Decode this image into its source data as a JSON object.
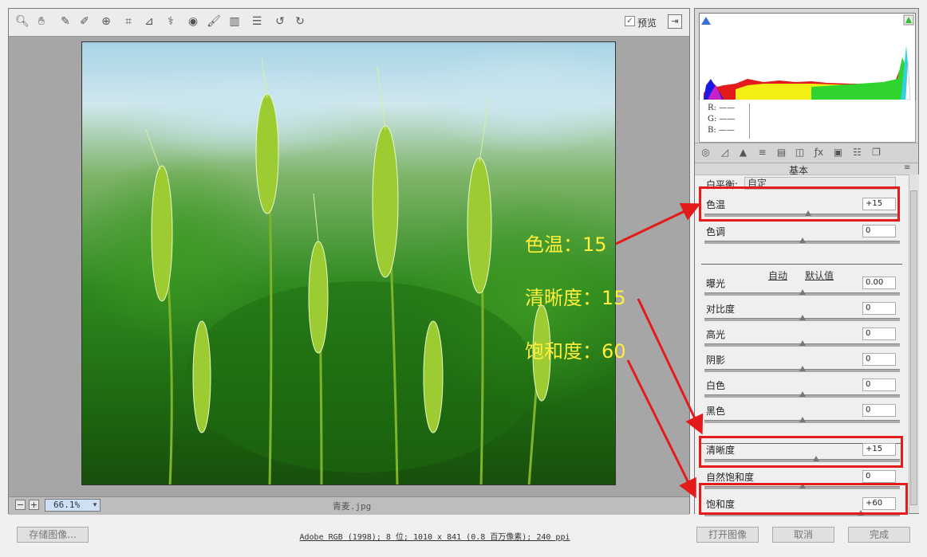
{
  "toolbar": {
    "tools": [
      "zoom-icon",
      "hand-icon",
      "eyedropper-icon",
      "color-sampler-icon",
      "target-adjust-icon",
      "crop-icon",
      "straighten-icon",
      "spot-removal-icon",
      "red-eye-icon",
      "brush-icon",
      "gradient-icon",
      "list-icon",
      "rotate-ccw-icon",
      "rotate-cw-icon"
    ],
    "preview_label": "预览",
    "preview_checked": true
  },
  "status": {
    "zoom_minus": "−",
    "zoom_plus": "+",
    "zoom": "66.1%",
    "filename": "青麦.jpg"
  },
  "histogram": {
    "r_label": "R:",
    "g_label": "G:",
    "b_label": "B:",
    "r_value": "——",
    "g_value": "——",
    "b_value": "——"
  },
  "panel": {
    "title": "基本",
    "white_balance_label": "白平衡:",
    "white_balance_value": "自定",
    "auto_label": "自动",
    "default_label": "默认值",
    "sliders": [
      {
        "label": "色温",
        "value": "+15",
        "position": 0.53
      },
      {
        "label": "色调",
        "value": "0",
        "position": 0.5
      },
      {
        "label": "曝光",
        "value": "0.00",
        "position": 0.5
      },
      {
        "label": "对比度",
        "value": "0",
        "position": 0.5
      },
      {
        "label": "高光",
        "value": "0",
        "position": 0.5
      },
      {
        "label": "阴影",
        "value": "0",
        "position": 0.5
      },
      {
        "label": "白色",
        "value": "0",
        "position": 0.5
      },
      {
        "label": "黑色",
        "value": "0",
        "position": 0.5
      },
      {
        "label": "清晰度",
        "value": "+15",
        "position": 0.57
      },
      {
        "label": "自然饱和度",
        "value": "0",
        "position": 0.5
      },
      {
        "label": "饱和度",
        "value": "+60",
        "position": 0.8
      }
    ]
  },
  "annotations": {
    "temp": "色温：15",
    "clarity": "清晰度：15",
    "saturation": "饱和度：60",
    "color": "#e31b1b"
  },
  "bottom": {
    "save_label": "存储图像...",
    "workflow": "Adobe RGB (1998); 8 位; 1010 x 841 (0.8 百万像素); 240 ppi",
    "open_label": "打开图像",
    "cancel_label": "取消",
    "done_label": "完成"
  }
}
